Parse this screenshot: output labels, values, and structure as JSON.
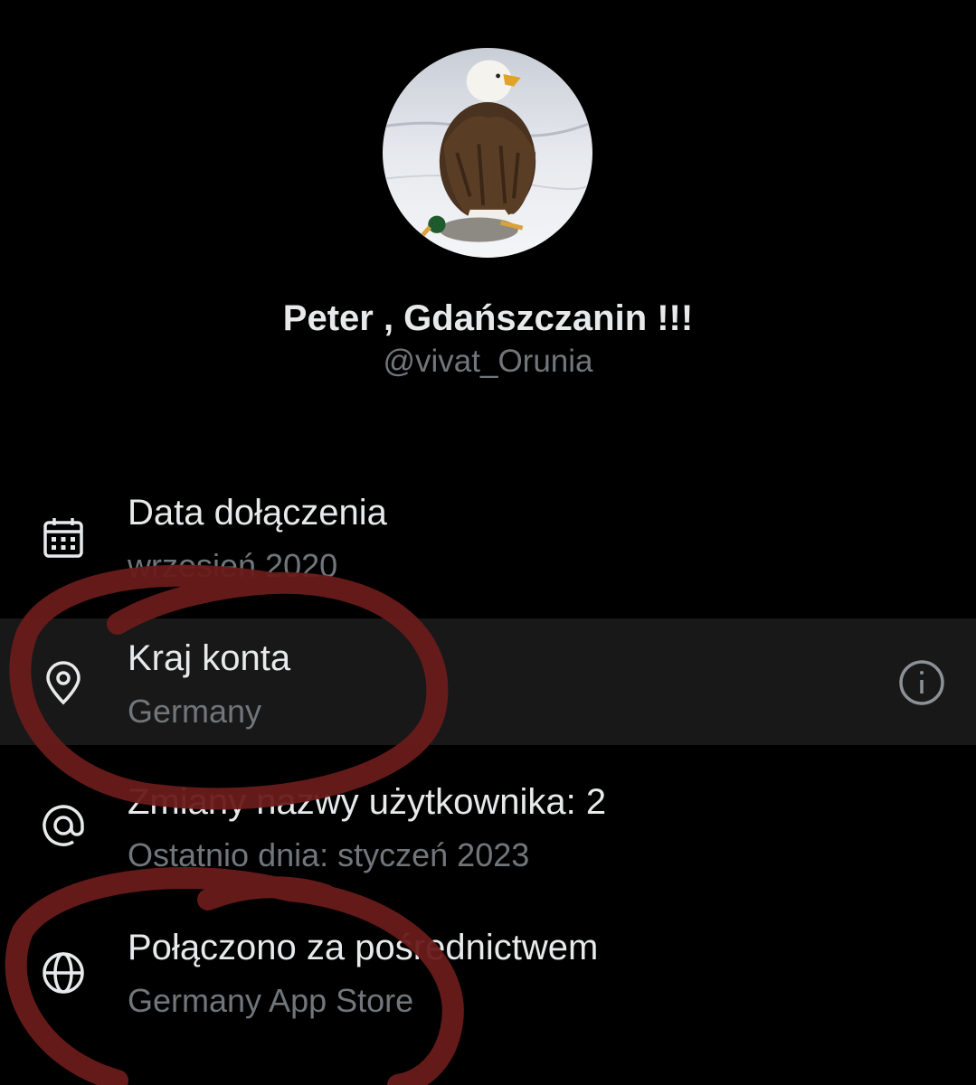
{
  "profile": {
    "display_name": "Peter , Gdańszczanin !!!",
    "handle": "@vivat_Orunia",
    "avatar_icon": "eagle-photo"
  },
  "details": [
    {
      "icon": "calendar-icon",
      "label": "Data dołączenia",
      "value": "wrzesień 2020"
    },
    {
      "icon": "location-pin-icon",
      "label": "Kraj konta",
      "value": "Germany",
      "highlighted": true,
      "action_icon": "info-icon"
    },
    {
      "icon": "at-sign-icon",
      "label": "Zmiany nazwy użytkownika: 2",
      "value": "Ostatnio dnia: styczeń 2023"
    },
    {
      "icon": "globe-icon",
      "label": "Połączono za pośrednictwem",
      "value": "Germany App Store"
    }
  ],
  "colors": {
    "background": "#000000",
    "primary_text": "#e7e9ea",
    "secondary_text": "#71767b",
    "highlight_row": "#181818",
    "annotation_marker": "#6a1b1b"
  }
}
